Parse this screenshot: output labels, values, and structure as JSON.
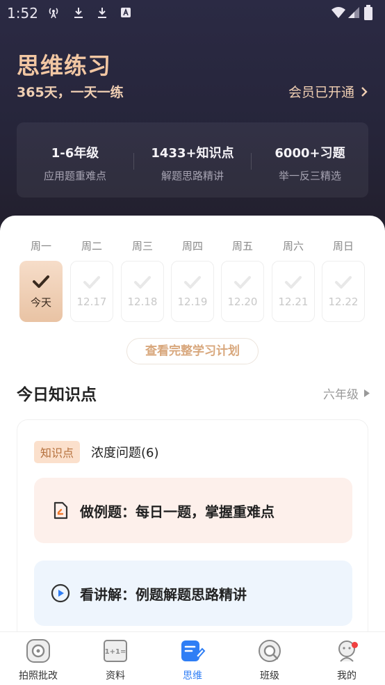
{
  "status_bar": {
    "time": "1:52",
    "icons": [
      "hotspot-icon",
      "download-icon",
      "download-icon",
      "a-icon",
      "wifi-icon",
      "signal-icon",
      "battery-icon"
    ]
  },
  "header": {
    "title": "思维练习",
    "subtitle": "365天，一天一练",
    "member_status": "会员已开通"
  },
  "stats": [
    {
      "value": "1-6年级",
      "label": "应用题重难点"
    },
    {
      "value": "1433+知识点",
      "label": "解题思路精讲"
    },
    {
      "value": "6000+习题",
      "label": "举一反三精选"
    }
  ],
  "week": [
    {
      "weekday": "周一",
      "date": "今天",
      "state": "done"
    },
    {
      "weekday": "周二",
      "date": "12.17",
      "state": "upcoming"
    },
    {
      "weekday": "周三",
      "date": "12.18",
      "state": "upcoming"
    },
    {
      "weekday": "周四",
      "date": "12.19",
      "state": "upcoming"
    },
    {
      "weekday": "周五",
      "date": "12.20",
      "state": "upcoming"
    },
    {
      "weekday": "周六",
      "date": "12.21",
      "state": "upcoming"
    },
    {
      "weekday": "周日",
      "date": "12.22",
      "state": "upcoming"
    }
  ],
  "plan_button": "查看完整学习计划",
  "knowledge": {
    "section_title": "今日知识点",
    "grade": "六年级",
    "tag": "知识点",
    "topic": "浓度问题(6)",
    "actions": [
      {
        "label": "做例题：每日一题，掌握重难点",
        "icon": "edit-doc-icon"
      },
      {
        "label": "看讲解：例题解题思路精讲",
        "icon": "play-icon"
      }
    ]
  },
  "tabbar": [
    {
      "label": "拍照批改",
      "icon": "camera-icon",
      "active": false
    },
    {
      "label": "资料",
      "icon": "book-icon",
      "active": false
    },
    {
      "label": "思维",
      "icon": "think-icon",
      "active": true
    },
    {
      "label": "班级",
      "icon": "class-icon",
      "active": false
    },
    {
      "label": "我的",
      "icon": "profile-icon",
      "active": false
    }
  ],
  "colors": {
    "hero_bg": "#26253a",
    "gold": "#f2c7a3",
    "active_tab": "#2f7ef5",
    "badge_dot": "#f04040"
  }
}
